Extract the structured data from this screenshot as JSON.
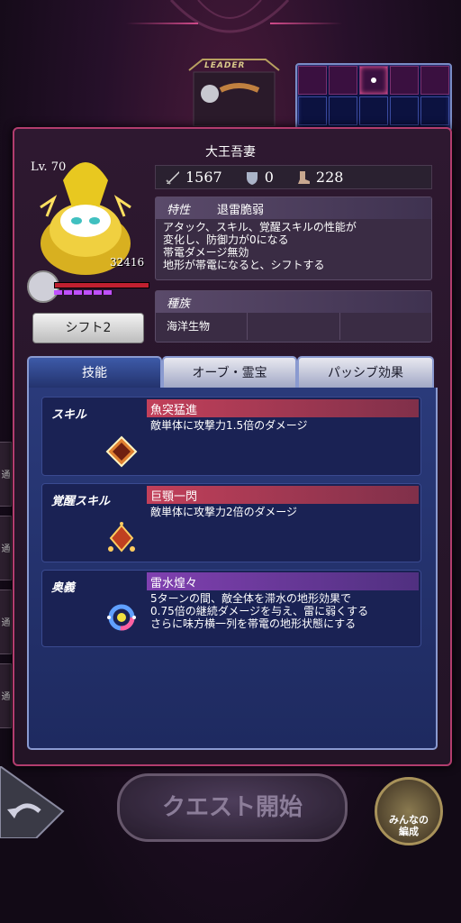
{
  "leader": {
    "label": "LEADER"
  },
  "side_tabs": [
    "通",
    "通",
    "通",
    "通"
  ],
  "character": {
    "name": "大王吾妻",
    "level": "Lv. 70",
    "hp": "32416",
    "shift_button": "シフト2"
  },
  "stats": {
    "attack": "1567",
    "defense": "0",
    "speed": "228"
  },
  "trait": {
    "tag": "特性",
    "name": "退雷脆弱",
    "description_lines": [
      "アタック、スキル、覚醒スキルの性能が",
      "変化し、防御力が0になる",
      "帯電ダメージ無効",
      "地形が帯電になると、シフトする"
    ]
  },
  "tribe": {
    "tag": "種族",
    "values": [
      "海洋生物",
      "",
      ""
    ]
  },
  "tabs": [
    {
      "label": "技能",
      "active": true
    },
    {
      "label": "オーブ・霊宝",
      "active": false
    },
    {
      "label": "パッシブ効果",
      "active": false
    }
  ],
  "skills": [
    {
      "type": "スキル",
      "name": "魚突猛進",
      "desc": [
        "敵単体に攻撃力1.5倍のダメージ"
      ]
    },
    {
      "type": "覚醒スキル",
      "name": "巨顎一閃",
      "desc": [
        "敵単体に攻撃力2倍のダメージ"
      ]
    },
    {
      "type": "奥義",
      "name": "雷水煌々",
      "desc": [
        "5ターンの間、敵全体を滞水の地形効果で",
        "0.75倍の継続ダメージを与え、雷に弱くする",
        "さらに味方横一列を帯電の地形状態にする"
      ]
    }
  ],
  "bottom": {
    "quest_button": "クエスト開始",
    "minna_line1": "みんなの",
    "minna_line2": "編成"
  },
  "colors": {
    "panel_border": "#b23d6e",
    "tab_active": "#2f4590",
    "skill_bar_red": "#c2405a",
    "skill_bar_purple": "#8040b0"
  }
}
